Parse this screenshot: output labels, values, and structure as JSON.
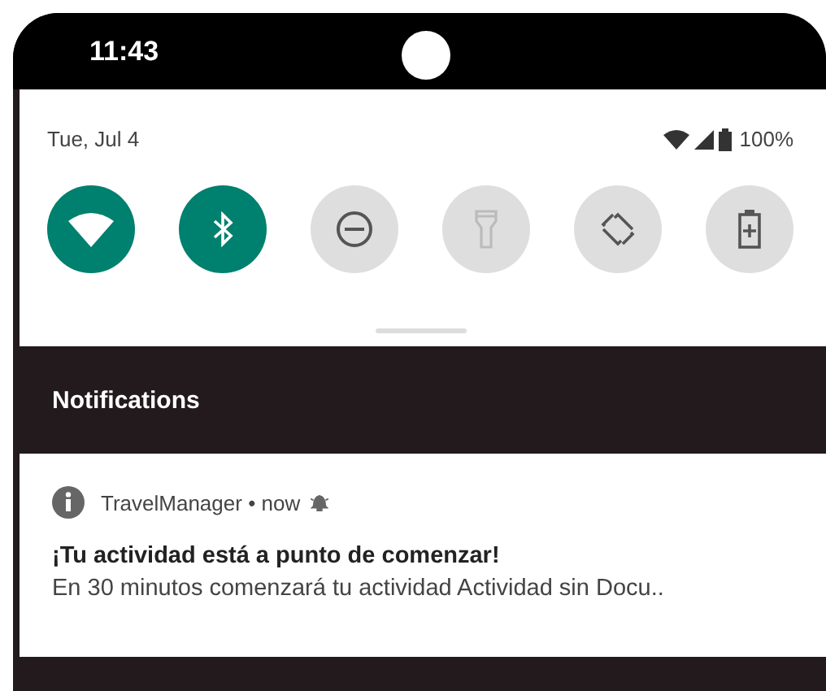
{
  "status_bar": {
    "time": "11:43"
  },
  "quick_settings": {
    "date": "Tue, Jul 4",
    "battery": "100%",
    "tiles": [
      {
        "kind": "wifi",
        "on": true,
        "disabled": false
      },
      {
        "kind": "bluetooth",
        "on": true,
        "disabled": false
      },
      {
        "kind": "dnd",
        "on": false,
        "disabled": false
      },
      {
        "kind": "flashlight",
        "on": false,
        "disabled": true
      },
      {
        "kind": "rotate",
        "on": false,
        "disabled": false
      },
      {
        "kind": "battery_saver",
        "on": false,
        "disabled": false
      }
    ]
  },
  "notifications": {
    "title": "Notifications",
    "items": [
      {
        "app": "TravelManager",
        "separator": "•",
        "time": "now",
        "title": "¡Tu actividad está a punto de comenzar!",
        "body": "En 30 minutos comenzará tu actividad Actividad sin Docu.."
      }
    ]
  }
}
